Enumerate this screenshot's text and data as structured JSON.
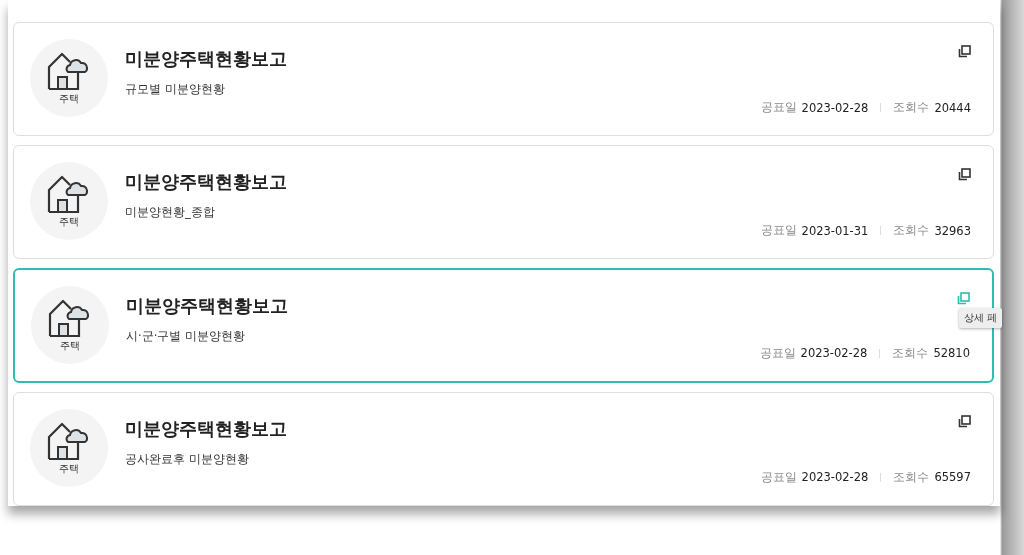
{
  "cards": [
    {
      "category": "주택",
      "title": "미분양주택현황보고",
      "subtitle": "규모별 미분양현황",
      "date_label": "공표일",
      "date": "2023-02-28",
      "views_label": "조회수",
      "views": "20444",
      "selected": false
    },
    {
      "category": "주택",
      "title": "미분양주택현황보고",
      "subtitle": "미분양현황_종합",
      "date_label": "공표일",
      "date": "2023-01-31",
      "views_label": "조회수",
      "views": "32963",
      "selected": false
    },
    {
      "category": "주택",
      "title": "미분양주택현황보고",
      "subtitle": "시·군·구별 미분양현황",
      "date_label": "공표일",
      "date": "2023-02-28",
      "views_label": "조회수",
      "views": "52810",
      "selected": true,
      "tooltip": "상세 페"
    },
    {
      "category": "주택",
      "title": "미분양주택현황보고",
      "subtitle": "공사완료후 미분양현황",
      "date_label": "공표일",
      "date": "2023-02-28",
      "views_label": "조회수",
      "views": "65597",
      "selected": false
    }
  ]
}
